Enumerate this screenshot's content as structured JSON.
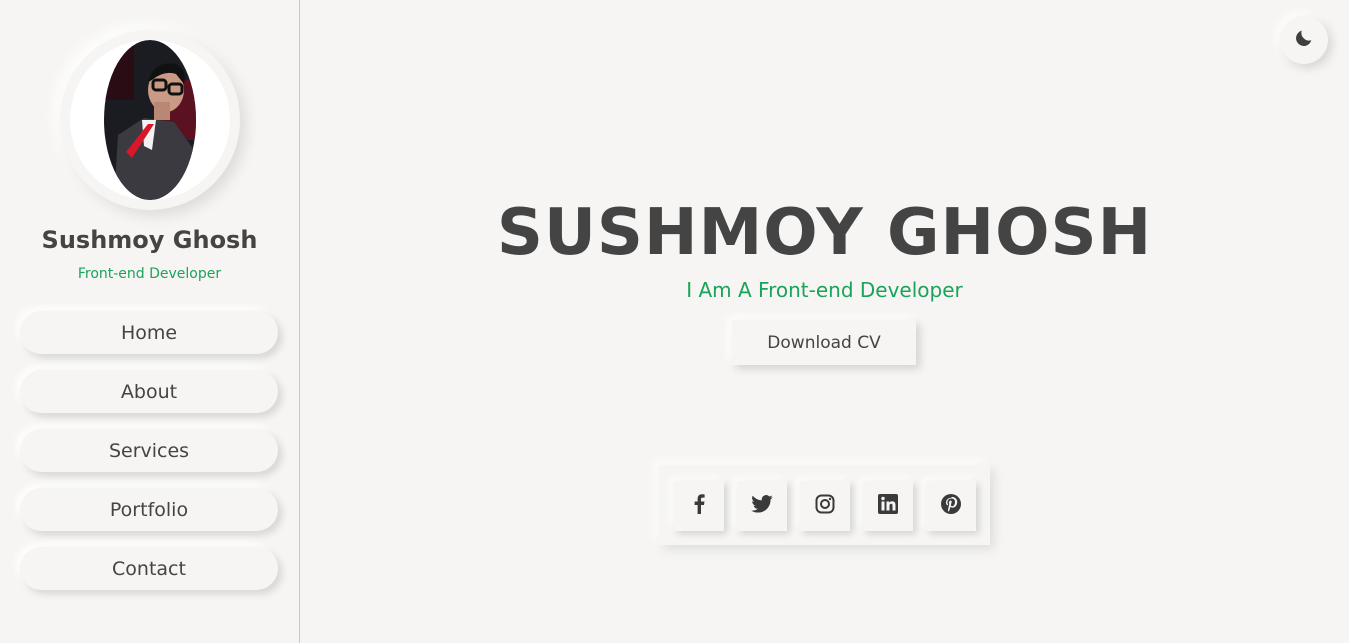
{
  "profile": {
    "name": "Sushmoy Ghosh",
    "role": "Front-end Developer"
  },
  "nav": {
    "items": [
      {
        "label": "Home"
      },
      {
        "label": "About"
      },
      {
        "label": "Services"
      },
      {
        "label": "Portfolio"
      },
      {
        "label": "Contact"
      }
    ]
  },
  "hero": {
    "title": "SUSHMOY GHOSH",
    "subtitle": "I Am A Front-end Developer",
    "cv_button": "Download CV"
  },
  "social": {
    "icons": [
      "facebook-icon",
      "twitter-icon",
      "instagram-icon",
      "linkedin-icon",
      "pinterest-icon"
    ]
  },
  "theme": {
    "toggle_icon": "moon-icon",
    "accent": "#1aa35a",
    "text": "#444444",
    "background": "#f6f5f3"
  }
}
